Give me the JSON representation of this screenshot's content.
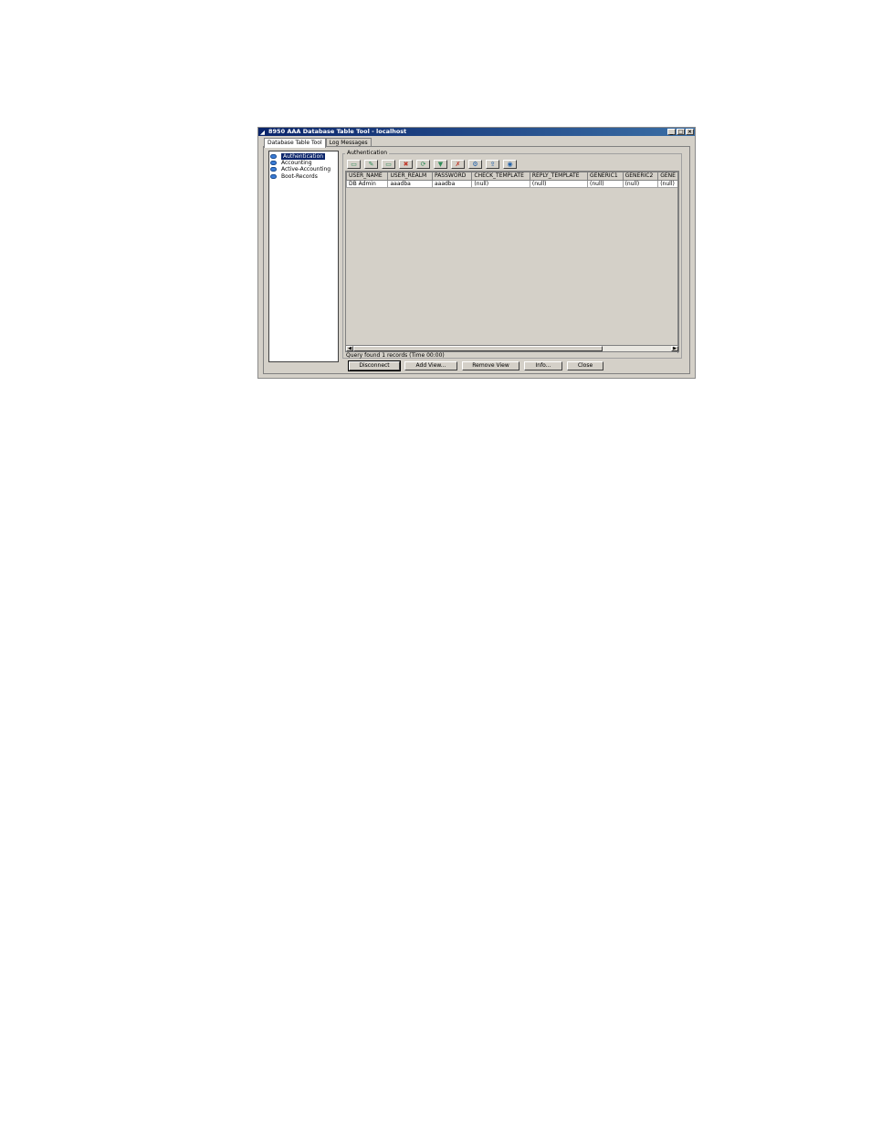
{
  "window": {
    "title": "8950 AAA Database Table Tool - localhost",
    "minimize": "_",
    "maximize": "□",
    "close": "×"
  },
  "tabs": [
    {
      "label": "Database Table Tool",
      "active": true
    },
    {
      "label": "Log Messages",
      "active": false
    }
  ],
  "tree": {
    "items": [
      {
        "label": "Authentication",
        "selected": true
      },
      {
        "label": "Accounting",
        "selected": false
      },
      {
        "label": "Active-Accounting",
        "selected": false
      },
      {
        "label": "Boot-Records",
        "selected": false
      }
    ]
  },
  "panel": {
    "title": "Authentication"
  },
  "toolbar": {
    "icons": [
      "view-icon",
      "edit-icon",
      "add-icon",
      "delete-icon",
      "refresh-icon",
      "filter-icon",
      "clear-filter-icon",
      "search-icon",
      "export-icon",
      "connect-icon"
    ],
    "glyphs": [
      "▭",
      "✎",
      "▭",
      "✖",
      "⟳",
      "▼",
      "✗",
      "⚙",
      "⇪",
      "◉"
    ],
    "colors": [
      "#2e8b57",
      "#2e8b57",
      "#2e8b57",
      "#c0392b",
      "#2e8b57",
      "#2e8b57",
      "#c0392b",
      "#1f5fa8",
      "#1f5fa8",
      "#1f5fa8"
    ]
  },
  "table": {
    "columns": [
      "USER_NAME",
      "USER_REALM",
      "PASSWORD",
      "CHECK_TEMPLATE",
      "REPLY_TEMPLATE",
      "GENERIC1",
      "GENERIC2",
      "GENE"
    ],
    "rows": [
      [
        "DB Admin",
        "aaadba",
        "aaadba",
        "(null)",
        "(null)",
        "(null)",
        "(null)",
        "(null)"
      ]
    ]
  },
  "status": {
    "text": "Query found 1 records (Time 00:00)"
  },
  "buttons": {
    "disconnect": "Disconnect",
    "add_view": "Add View...",
    "remove_view": "Remove View",
    "info": "Info...",
    "close": "Close"
  },
  "scroll": {
    "left": "◀",
    "right": "▶"
  }
}
